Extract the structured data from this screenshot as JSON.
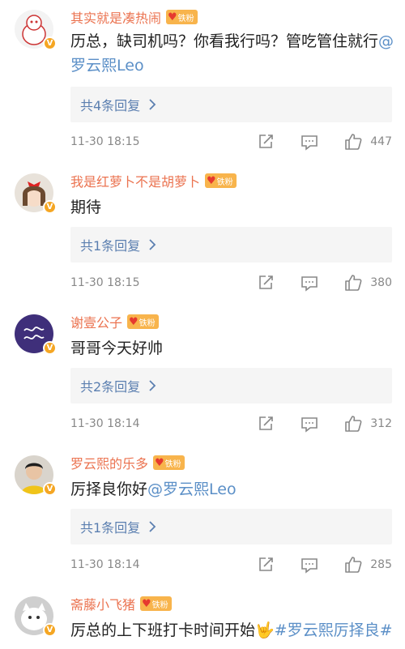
{
  "fan_badge_text": "铁粉",
  "verified_mark": "V",
  "colors": {
    "username": "#eb7350",
    "mention": "#5b8fc7",
    "reply_link": "#5b7fb0",
    "badge": "#f8b44c"
  },
  "comments": [
    {
      "username": "其实就是凑热闹",
      "text_a": "历总，缺司机吗？你看我行吗？管吃管住就行",
      "mention": "@罗云熙Leo",
      "text_b": "",
      "replies": "共4条回复",
      "time": "11-30 18:15",
      "likes": "447"
    },
    {
      "username": "我是红萝卜不是胡萝卜",
      "text_a": "期待",
      "mention": "",
      "text_b": "",
      "replies": "共1条回复",
      "time": "11-30 18:15",
      "likes": "380"
    },
    {
      "username": "谢壹公子",
      "text_a": "哥哥今天好帅",
      "mention": "",
      "text_b": "",
      "replies": "共2条回复",
      "time": "11-30 18:14",
      "likes": "312"
    },
    {
      "username": "罗云熙的乐多",
      "text_a": "厉择良你好",
      "mention": "@罗云熙Leo",
      "text_b": "",
      "replies": "共1条回复",
      "time": "11-30 18:14",
      "likes": "285"
    },
    {
      "username": "斋藤小飞猪",
      "text_a": "厉总的上下班打卡时间开始",
      "mention": "",
      "text_b": "🤟#罗云熙厉择良#"
    }
  ],
  "icons": [
    "share-icon",
    "comment-icon",
    "like-icon",
    "chevron-right-icon"
  ]
}
